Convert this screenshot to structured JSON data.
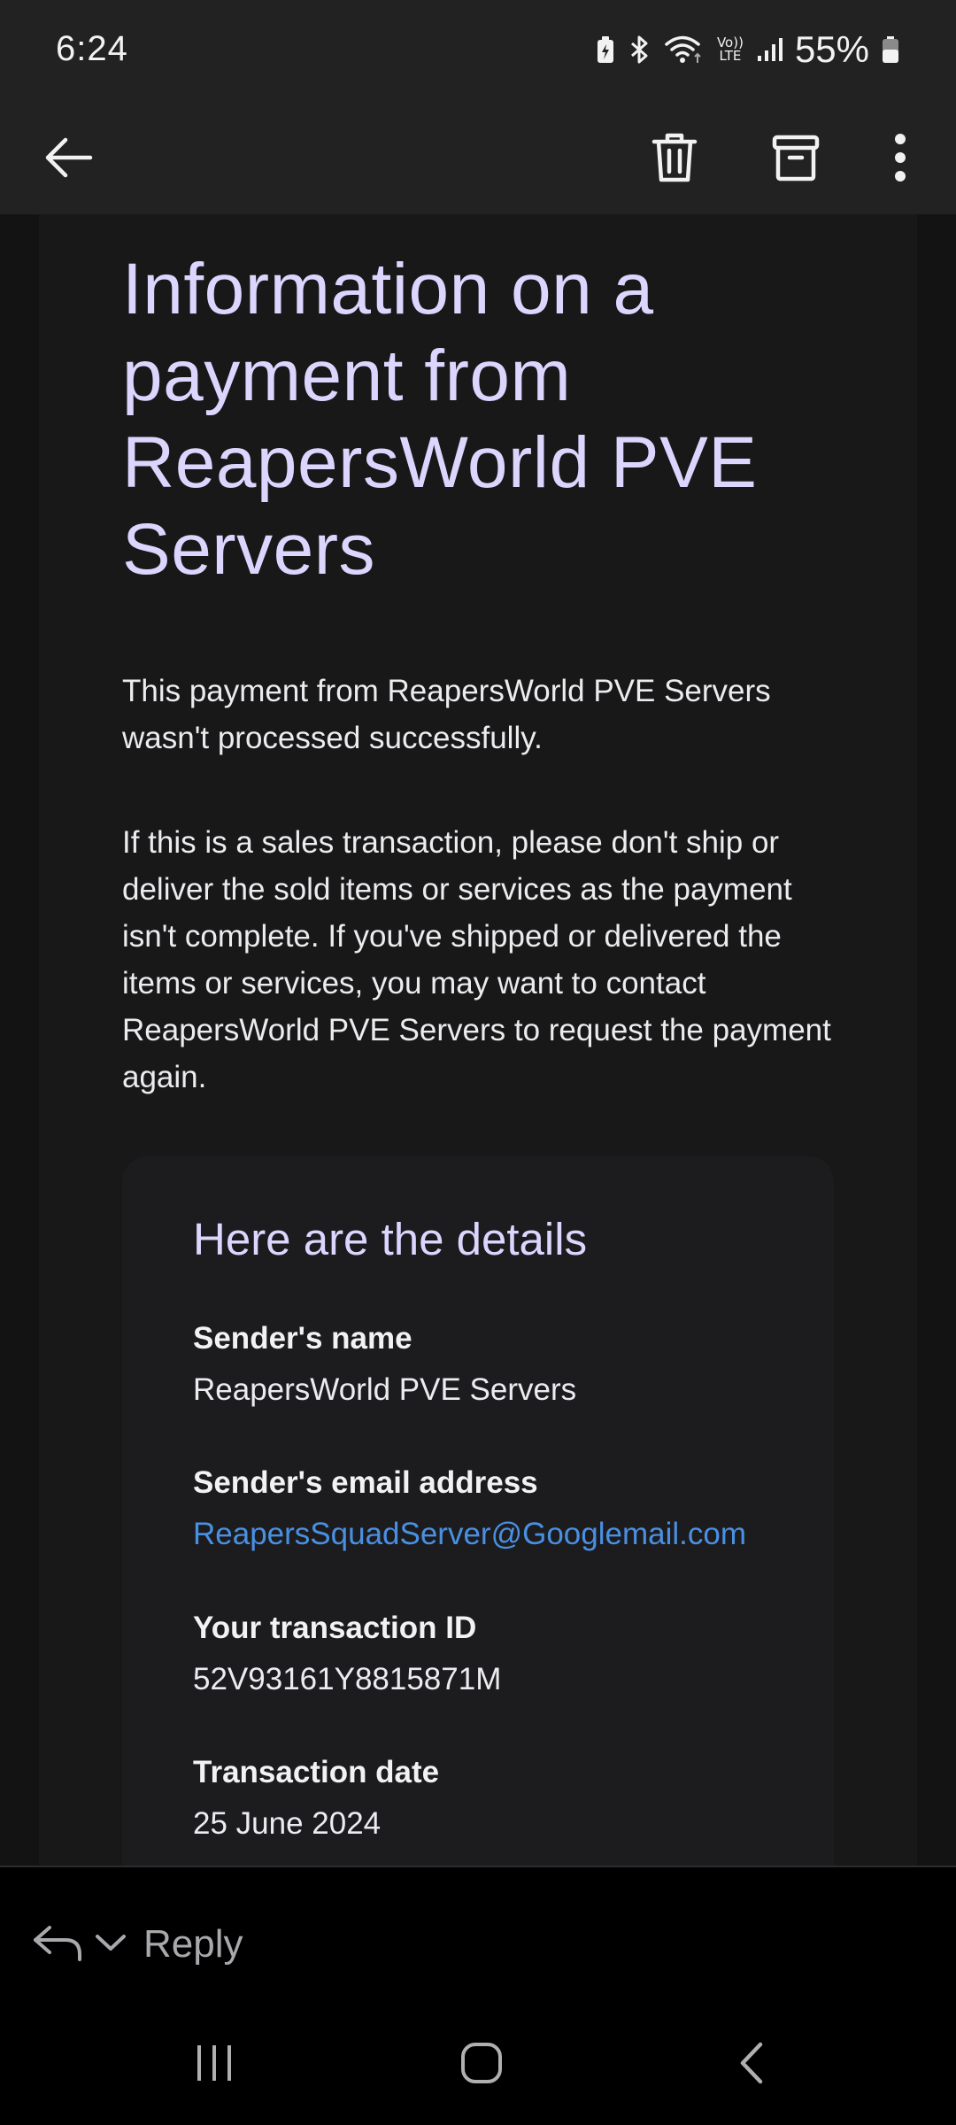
{
  "status_bar": {
    "time": "6:24",
    "volte_top": "Vo))",
    "volte_bottom": "LTE",
    "battery_percent": "55%",
    "icons": [
      "battery-saver-icon",
      "bluetooth-icon",
      "wifi-icon",
      "volte-icon",
      "signal-icon",
      "battery-icon"
    ]
  },
  "toolbar": {
    "icons": [
      "back-arrow-icon",
      "trash-icon",
      "archive-icon",
      "more-vertical-icon"
    ]
  },
  "email": {
    "heading": "Information on a payment from ReapersWorld PVE Servers",
    "paragraph_1": "This payment from ReapersWorld PVE Servers wasn't processed successfully.",
    "paragraph_2": "If this is a sales transaction, please don't ship or deliver the sold items or services as the payment isn't complete. If you've shipped or delivered the items or services, you may want to contact ReapersWorld PVE Servers to request the payment again.",
    "details": {
      "title": "Here are the details",
      "sender_name_label": "Sender's name",
      "sender_name": "ReapersWorld PVE Servers",
      "sender_email_label": "Sender's email address",
      "sender_email": "ReapersSquadServer@Googlemail.com",
      "transaction_id_label": "Your transaction ID",
      "transaction_id": "52V93161Y8815871M",
      "transaction_date_label": "Transaction date",
      "transaction_date": "25 June 2024"
    }
  },
  "reply_bar": {
    "label": "Reply",
    "icons": [
      "reply-arrow-icon",
      "chevron-down-icon"
    ]
  },
  "nav_bar": {
    "icons": [
      "recents-icon",
      "home-icon",
      "back-icon"
    ]
  },
  "colors": {
    "heading": "#dcd6ff",
    "link": "#4a90e2",
    "toolbar_bg": "#222222",
    "content_bg": "#181818"
  }
}
